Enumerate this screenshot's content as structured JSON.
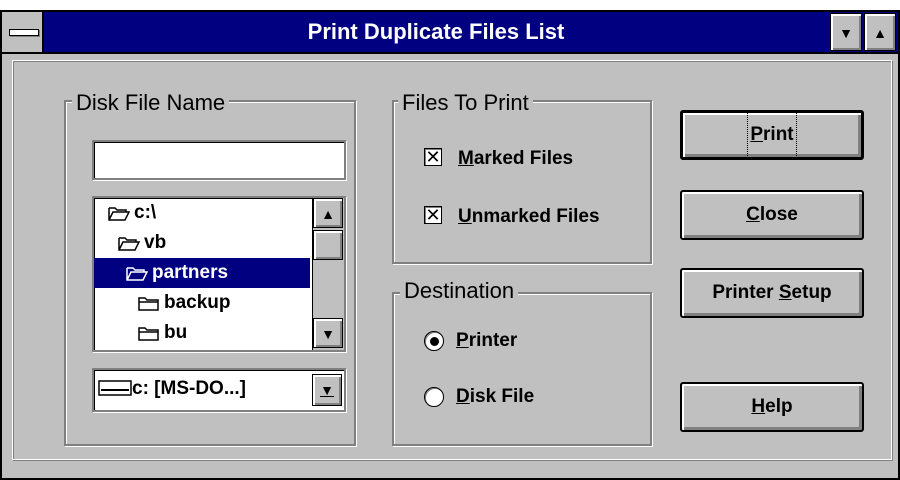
{
  "window": {
    "title": "Print Duplicate Files List",
    "minimize_glyph": "▼",
    "maximize_glyph": "▲"
  },
  "disk_file": {
    "legend": "Disk File Name",
    "filename_value": "",
    "directories": [
      {
        "label": "c:\\",
        "icon": "folder-open-icon",
        "selected": false
      },
      {
        "label": "vb",
        "icon": "folder-open-icon",
        "selected": false
      },
      {
        "label": "partners",
        "icon": "folder-open-icon",
        "selected": true
      },
      {
        "label": "backup",
        "icon": "folder-closed-icon",
        "selected": false
      },
      {
        "label": "bu",
        "icon": "folder-closed-icon",
        "selected": false
      }
    ],
    "drive_value": "c: [MS-DO...]",
    "scroll_up_glyph": "▲",
    "scroll_down_glyph": "▼",
    "dropdown_glyph": "▼"
  },
  "files_to_print": {
    "legend": "Files To Print",
    "marked": {
      "mnemonic": "M",
      "rest": "arked Files",
      "checked": true
    },
    "unmarked": {
      "mnemonic": "U",
      "rest": "nmarked Files",
      "checked": true
    }
  },
  "destination": {
    "legend": "Destination",
    "printer": {
      "mnemonic": "P",
      "rest": "rinter",
      "selected": true
    },
    "disk_file": {
      "mnemonic": "D",
      "rest": "isk File",
      "selected": false
    }
  },
  "buttons": {
    "print": {
      "mnemonic": "P",
      "rest": "rint"
    },
    "close": {
      "mnemonic": "C",
      "rest": "lose"
    },
    "printer_setup": {
      "before": "Printer ",
      "mnemonic": "S",
      "rest": "etup"
    },
    "help": {
      "mnemonic": "H",
      "rest": "elp"
    }
  },
  "colors": {
    "title_bar": "#000080",
    "face": "#c0c0c0",
    "selection": "#000080"
  }
}
